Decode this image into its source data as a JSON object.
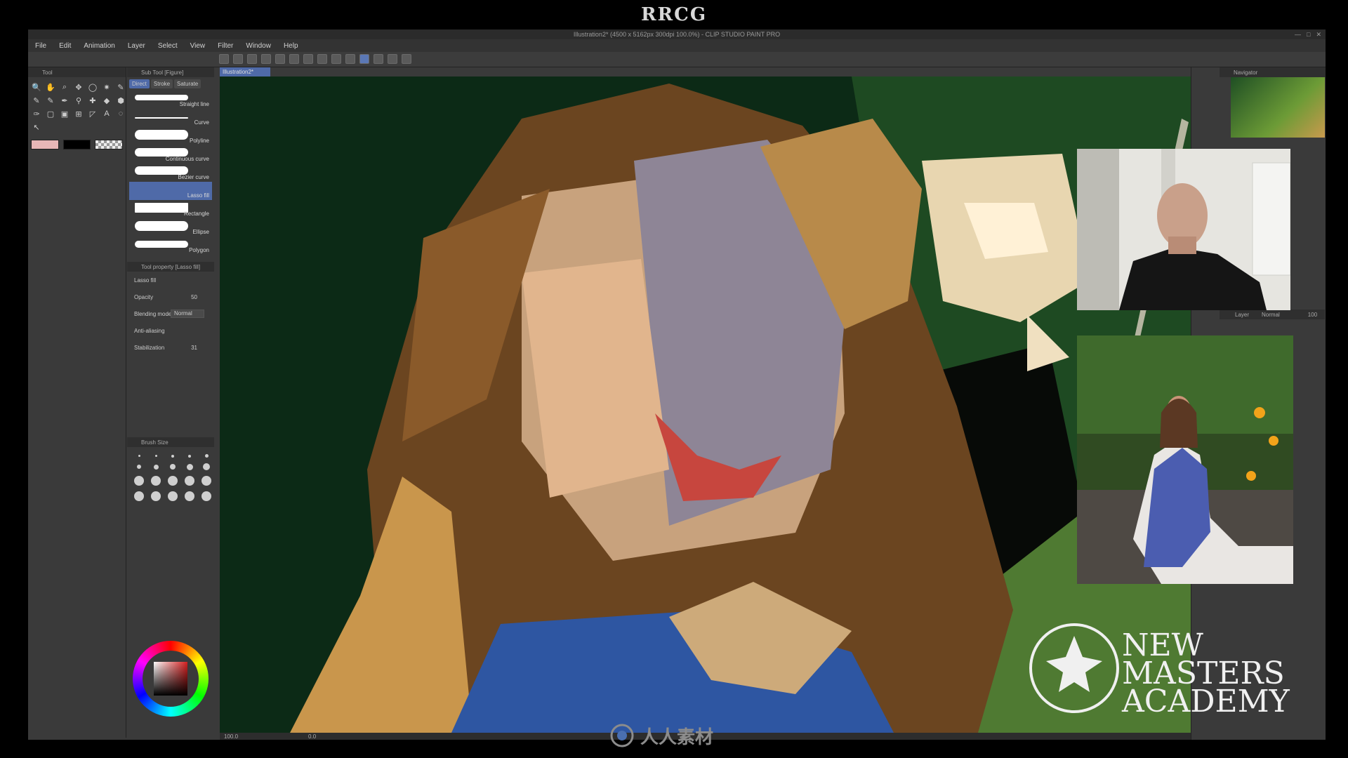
{
  "banner": {
    "text": "RRCG"
  },
  "window": {
    "title": "Illustration2* (4500 x 5162px 300dpi 100.0%) - CLIP STUDIO PAINT PRO",
    "controls": [
      "—",
      "□",
      "✕"
    ]
  },
  "menu": [
    "File",
    "Edit",
    "Animation",
    "Layer",
    "Select",
    "View",
    "Filter",
    "Window",
    "Help"
  ],
  "tool_panel": {
    "title": "Tool",
    "tools": [
      "🔍",
      "✋",
      "⌕",
      "✥",
      "◯",
      "✷",
      "✎",
      "✎",
      "✎",
      "✒",
      "⚲",
      "✚",
      "◆",
      "⬢",
      "✑",
      "▢",
      "▣",
      "⊞",
      "◸",
      "A",
      "◌",
      "↖"
    ]
  },
  "sub_tool_panel": {
    "title": "Sub Tool [Figure]",
    "tabs": [
      "Direct",
      "Stroke",
      "Saturate"
    ],
    "items": [
      "Straight line",
      "Curve",
      "Polyline",
      "Continuous curve",
      "Bezier curve",
      "Lasso fill",
      "Rectangle",
      "Ellipse",
      "Polygon"
    ],
    "active_item": "Lasso fill"
  },
  "tool_property": {
    "title": "Tool property [Lasso fill]",
    "tool_name": "Lasso fill",
    "opacity_label": "Opacity",
    "opacity_value": "50",
    "blending_label": "Blending mode",
    "blending_value": "Normal",
    "antialias_label": "Anti-aliasing",
    "stabilization_label": "Stabilization",
    "stabilization_value": "31"
  },
  "brush_size": {
    "title": "Brush Size"
  },
  "document_tab": {
    "label": "Illustration2*"
  },
  "status": {
    "zoom": "100.0",
    "angle": "0.0"
  },
  "navigator": {
    "title": "Navigator"
  },
  "layer_panel": {
    "title": "Layer",
    "blend": "Normal",
    "opacity": "100"
  },
  "logo": {
    "line1": "NEW",
    "line2": "MASTERS",
    "line3": "ACADEMY"
  },
  "watermark": {
    "text": "人人素材"
  }
}
